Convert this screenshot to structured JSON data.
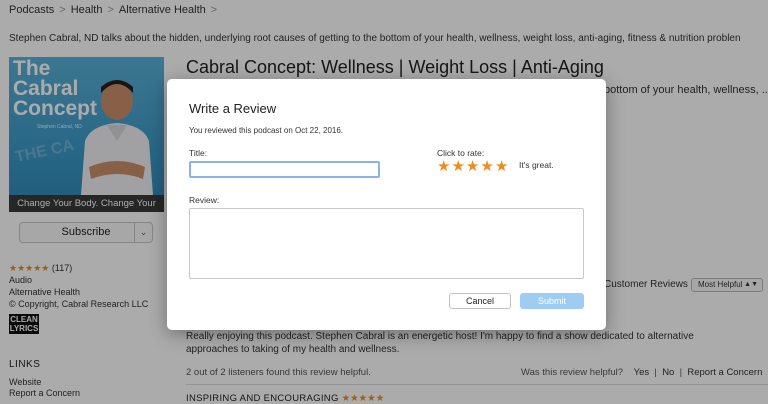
{
  "breadcrumb": {
    "items": [
      "Podcasts",
      "Health",
      "Alternative Health"
    ],
    "separator": ">"
  },
  "header": {
    "description": "Stephen Cabral, ND talks about the hidden, underlying root causes of getting to the bottom of your health, wellness, weight loss, anti-aging, fitness & nutrition problen"
  },
  "artwork": {
    "title": "The Cabral Concept",
    "subtitle": "Stephen Cabral, ND",
    "watermark": "THE CA",
    "tagline": "Change Your Body. Change Your Life."
  },
  "subscribe": {
    "label": "Subscribe",
    "caret": "⌄"
  },
  "sidebar_meta": {
    "stars": "★★★★★",
    "rating_count": "(117)",
    "language": "Audio",
    "category": "Alternative Health",
    "copyright": "© Copyright, Cabral Research LLC",
    "clean_badge": "CLEAN",
    "clean_badge_sub": "LYRICS"
  },
  "links": {
    "heading": "LINKS",
    "items": [
      "Website",
      "Report a Concern"
    ]
  },
  "podcast": {
    "title": "Cabral Concept: Wellness | Weight Loss | Anti-Aging",
    "description_tail": "bottom of your health, wellness, ..."
  },
  "reviews": {
    "heading": "Customer Reviews",
    "sort_selected": "Most Helpful",
    "review_body": "Really enjoying this podcast. Stephen Cabral is an energetic host! I'm happy to find a show dedicated to alternative approaches to taking of my health and wellness.",
    "helpful_count_text": "2 out of 2 listeners found this review helpful.",
    "was_helpful": "Was this review helpful?",
    "yes": "Yes",
    "no": "No",
    "report": "Report a Concern",
    "next_title": "INSPIRING AND ENCOURAGING",
    "next_stars": "★★★★★"
  },
  "modal": {
    "title": "Write a Review",
    "subtitle": "You reviewed this podcast on Oct 22, 2016.",
    "title_label": "Title:",
    "title_value": "",
    "rate_label": "Click to rate:",
    "rating": 5,
    "rating_text": "It's great.",
    "review_label": "Review:",
    "review_value": "",
    "cancel_label": "Cancel",
    "submit_label": "Submit"
  },
  "colors": {
    "star_orange": "#f08c1a",
    "submit_disabled": "#9fcdf2",
    "focus_ring": "#8ab4e6",
    "artwork_blue": "#3d9ac9"
  }
}
